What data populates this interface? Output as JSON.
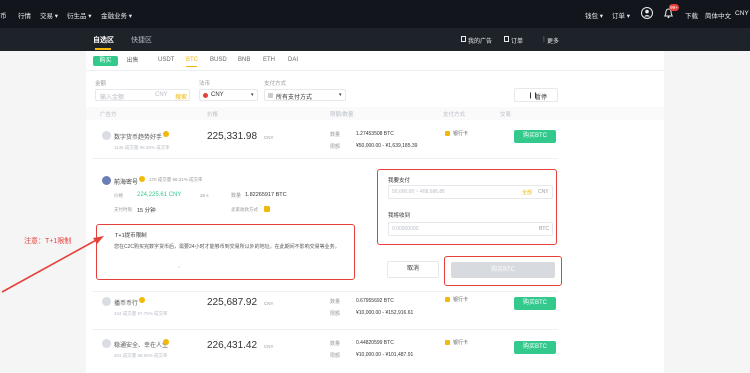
{
  "colors": {
    "accent": "#f0b90b",
    "green": "#33c98c",
    "red": "#e5413a",
    "dark": "#12161c"
  },
  "topbar": {
    "nav": [
      "币",
      "行情",
      "交易 ▾",
      "衍生品 ▾",
      "金融业务 ▾"
    ],
    "right": [
      "钱包 ▾",
      "订单 ▾",
      "下载",
      "简体中文",
      "CNY"
    ],
    "notification_count": "99+"
  },
  "subnav": {
    "tabs": [
      "自选区",
      "快捷区"
    ],
    "actions": [
      "我的广告",
      "订单",
      "更多"
    ]
  },
  "trade": {
    "buy": "购买",
    "sell": "出售",
    "coins": [
      "USDT",
      "BTC",
      "BUSD",
      "BNB",
      "ETH",
      "DAI"
    ]
  },
  "filters": {
    "amount_label": "金额",
    "amount_placeholder": "输入金额",
    "amount_unit": "CNY",
    "search": "搜索",
    "fiat_label": "法币",
    "fiat_value": "CNY",
    "pay_label": "支付方式",
    "pay_value": "所有支付方式",
    "pause": "暂停"
  },
  "columns": [
    "广告方",
    "价格",
    "限额/数量",
    "支付方式",
    "交易"
  ],
  "rows": [
    {
      "name": "数字货币趋势好手",
      "stats": "1136 成交量  98.38% 成交率",
      "price": "225,331.98",
      "unit": "CNY",
      "qty_label": "数量",
      "qty": "1.27453508 BTC",
      "limit_label": "限额",
      "limit": "¥50,000.00 - ¥1,639,185.39",
      "pay": "银行卡",
      "action": "购买BTC"
    },
    {
      "name": "播币币行",
      "stats": "434 成交量  97.75% 成交率",
      "price": "225,687.92",
      "unit": "CNY",
      "qty_label": "数量",
      "qty": "0.67955692 BTC",
      "limit_label": "限额",
      "limit": "¥10,000.00 - ¥152,916.61",
      "pay": "银行卡",
      "action": "购买BTC"
    },
    {
      "name": "稳通安全、幸在人生",
      "stats": "802 成交量  98.89% 成交率",
      "price": "226,431.42",
      "unit": "CNY",
      "qty_label": "数量",
      "qty": "0.44820599 BTC",
      "limit_label": "限额",
      "limit": "¥10,000.00 - ¥101,487.91",
      "pay": "银行卡",
      "action": "购买BTC"
    }
  ],
  "expanded": {
    "name": "前海密号",
    "stats": "170 成交量  98.21% 成交率",
    "price_label": "价格",
    "price": "224,225.61 CNY",
    "price_time": "28 s",
    "qty_label": "数量",
    "qty": "1.82265917 BTC",
    "time_label": "支付时限",
    "time": "15 分钟",
    "method_label": "卖家收款方式",
    "notice_title": "T+1提币限制",
    "notice_text": "您在C2C购买完数字货币后，需要24小时才能够币到交易所以外的地址。在此期间不影响交易等业务。",
    "want_pay_label": "我要支付",
    "want_pay_placeholder": "50,000.00 ~ 408,686.86",
    "all": "全部",
    "pay_unit": "CNY",
    "receive_label": "我将收到",
    "receive_placeholder": "0.00000000",
    "receive_unit": "BTC",
    "cancel": "取消",
    "buy": "购买BTC"
  },
  "annotation": "注意：T+1限制"
}
